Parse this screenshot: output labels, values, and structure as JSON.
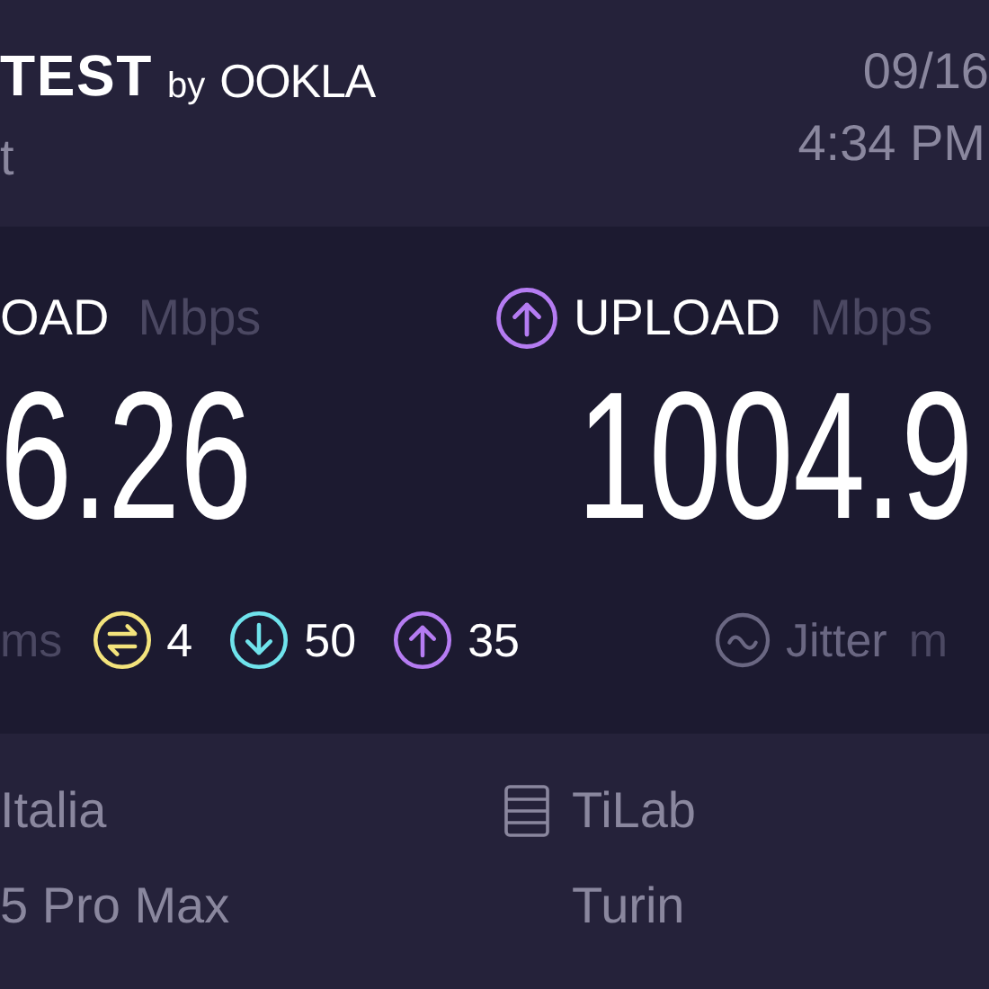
{
  "header": {
    "logo": {
      "title": "TEST",
      "by": "by",
      "brand": "OOKLA"
    },
    "subtitle": "t",
    "date": "09/16",
    "time": "4:34 PM"
  },
  "results": [
    {
      "label": "OAD",
      "unit": "Mbps",
      "value": "6.26"
    },
    {
      "kind": "upload",
      "label": "UPLOAD",
      "unit": "Mbps",
      "value": "1004.9"
    }
  ],
  "latency": {
    "unit": "ms",
    "items": [
      {
        "kind": "idle",
        "value": "4"
      },
      {
        "kind": "download",
        "value": "50"
      },
      {
        "kind": "upload",
        "value": "35"
      }
    ],
    "jitter": {
      "label": "Jitter",
      "unit": "m"
    }
  },
  "info": {
    "left": [
      "Italia",
      "5 Pro Max"
    ],
    "server": {
      "name": "TiLab",
      "location": "Turin"
    }
  }
}
